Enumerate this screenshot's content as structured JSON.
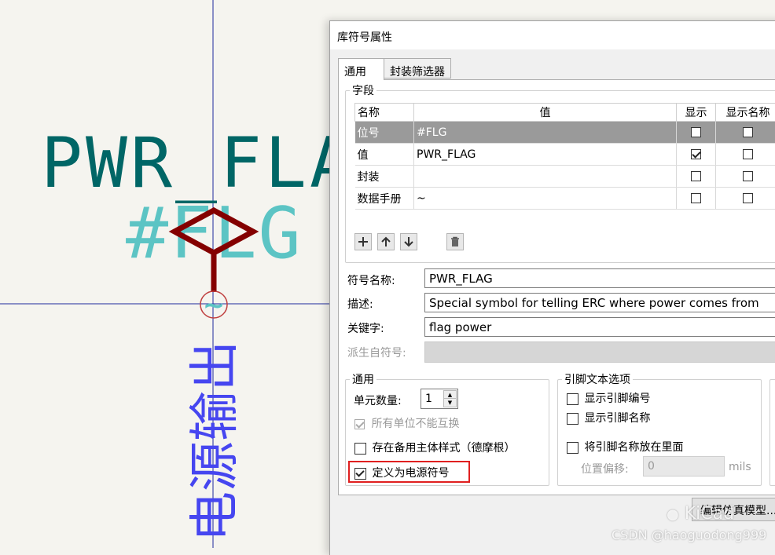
{
  "schematic": {
    "value_text": "PWR_FLA",
    "ref_text": "#FLG",
    "vertical_label": "电源输出",
    "tilde": "~"
  },
  "dialog": {
    "title": "库符号属性",
    "tabs": [
      "通用",
      "封装筛选器"
    ],
    "fields_group": {
      "label": "字段",
      "columns": [
        "名称",
        "值",
        "显示",
        "显示名称"
      ],
      "rows": [
        {
          "name": "位号",
          "value": "#FLG",
          "show": false,
          "show_name": false,
          "selected": true
        },
        {
          "name": "值",
          "value": "PWR_FLAG",
          "show": true,
          "show_name": false,
          "selected": false
        },
        {
          "name": "封装",
          "value": "",
          "show": false,
          "show_name": false,
          "selected": false
        },
        {
          "name": "数据手册",
          "value": "~",
          "show": false,
          "show_name": false,
          "selected": false
        }
      ],
      "toolbar_icons": [
        "add-icon",
        "move-up-icon",
        "move-down-icon",
        "trash-icon"
      ]
    },
    "symbol_name_label": "符号名称:",
    "symbol_name_value": "PWR_FLAG",
    "description_label": "描述:",
    "description_value": "Special symbol for telling ERC where power comes from",
    "keywords_label": "关键字:",
    "keywords_value": "flag power",
    "derived_label": "派生自符号:",
    "general_group": {
      "label": "通用",
      "units_label": "单元数量:",
      "units_value": "1",
      "interchangeable_label": "所有单位不能互换",
      "interchangeable_checked": true,
      "alt_style_label": "存在备用主体样式（德摩根）",
      "alt_style_checked": false,
      "power_symbol_label": "定义为电源符号",
      "power_symbol_checked": true
    },
    "pin_text_group": {
      "label": "引脚文本选项",
      "show_pin_number_label": "显示引脚编号",
      "show_pin_name_label": "显示引脚名称",
      "pin_names_inside_label": "将引脚名称放在里面",
      "offset_label": "位置偏移:",
      "offset_value": "0",
      "offset_unit": "mils"
    },
    "sim_button_label": "编辑仿真模型..."
  },
  "watermarks": {
    "brand": "KiCad",
    "credit": "CSDN @haoguodong999"
  },
  "colors": {
    "canvas_bg": "#f5f4ef",
    "value_text": "#006666",
    "ref_text": "#5cc4c4",
    "symbol_body": "#840000",
    "pin_label": "#4646f0",
    "crosshair": "#1e2a9c",
    "highlight_box": "#e02020"
  }
}
